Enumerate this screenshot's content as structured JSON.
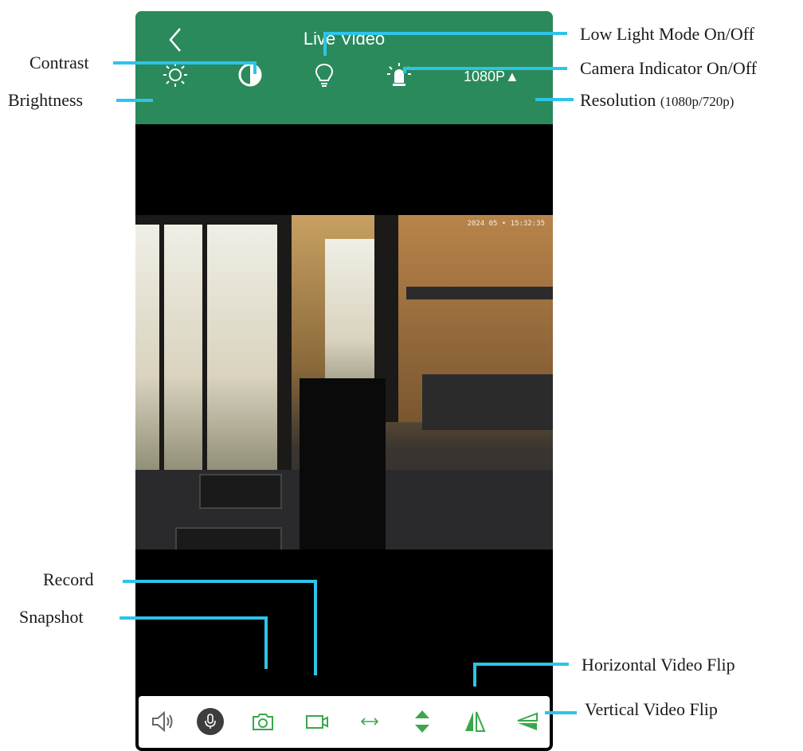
{
  "colors": {
    "header": "#2a8a5c",
    "accent_green": "#3aa84a",
    "callout_line": "#2ec4e8",
    "toolbar_icon_gray": "#666666"
  },
  "header": {
    "back_icon": "chevron-left-icon",
    "title": "Live Video",
    "icons": [
      "brightness-icon",
      "contrast-icon",
      "lightbulb-icon",
      "camera-indicator-icon"
    ],
    "resolution": "1080P▲"
  },
  "video": {
    "timestamp": "2024 05 • 15:32:35"
  },
  "toolbar": {
    "icons": [
      "speaker-icon",
      "microphone-icon",
      "snapshot-camera-icon",
      "record-video-icon",
      "horizontal-arrows-icon",
      "vertical-arrows-icon",
      "horizontal-flip-icon",
      "vertical-flip-icon"
    ]
  },
  "callouts": {
    "contrast": "Contrast",
    "brightness": "Brightness",
    "low_light": "Low Light Mode On/Off",
    "camera_indicator": "Camera Indicator On/Off",
    "resolution": "Resolution",
    "resolution_detail": "(1080p/720p)",
    "record": "Record",
    "snapshot": "Snapshot",
    "horizontal_flip": "Horizontal Video Flip",
    "vertical_flip": "Vertical Video Flip"
  }
}
